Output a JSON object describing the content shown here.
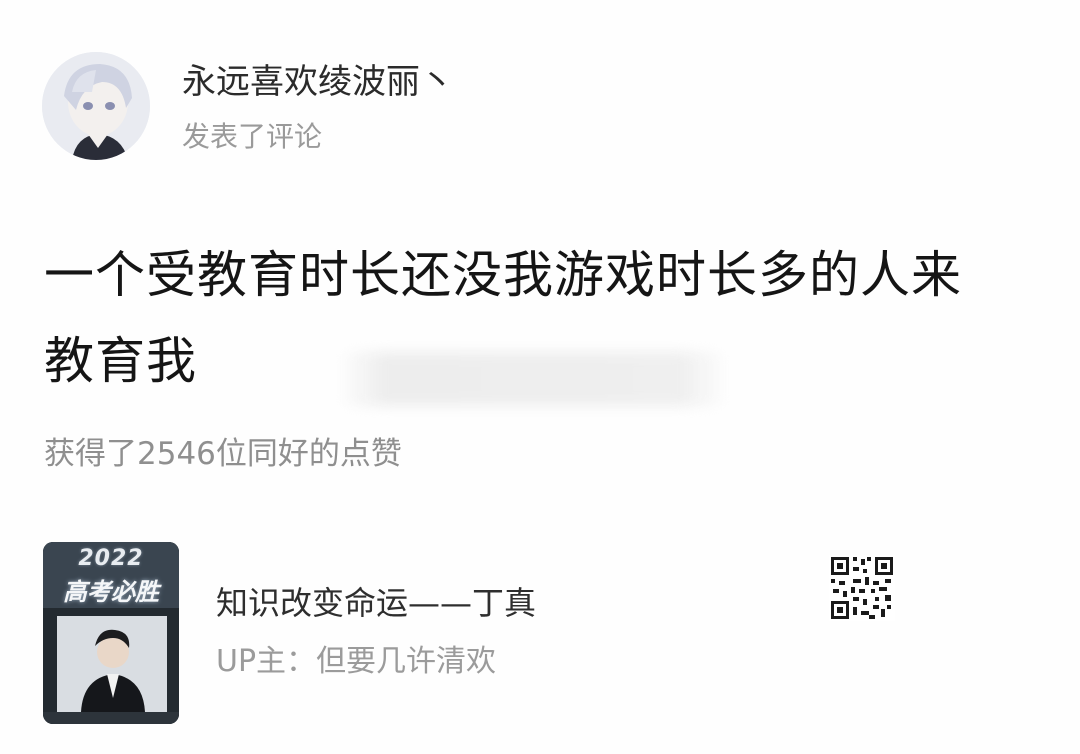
{
  "comment_card": {
    "author": {
      "name": "永远喜欢绫波丽丶",
      "action": "发表了评论",
      "avatar_icon": "anime-avatar-icon"
    },
    "body": {
      "line1": "一个受教育时长还没我游戏时长多的人来",
      "line2": "教育我"
    },
    "likes_text": "获得了2546位同好的点赞"
  },
  "video": {
    "thumbnail": {
      "year": "2022",
      "slogan": "高考必胜"
    },
    "title": "知识改变命运——丁真",
    "uploader": "UP主：但要几许清欢",
    "qr_icon": "qr-code-icon"
  },
  "colors": {
    "username": "#2b2b2b",
    "secondary": "#9a9a9a",
    "body": "#151515",
    "thumbnail_bg": "#1d2226"
  }
}
